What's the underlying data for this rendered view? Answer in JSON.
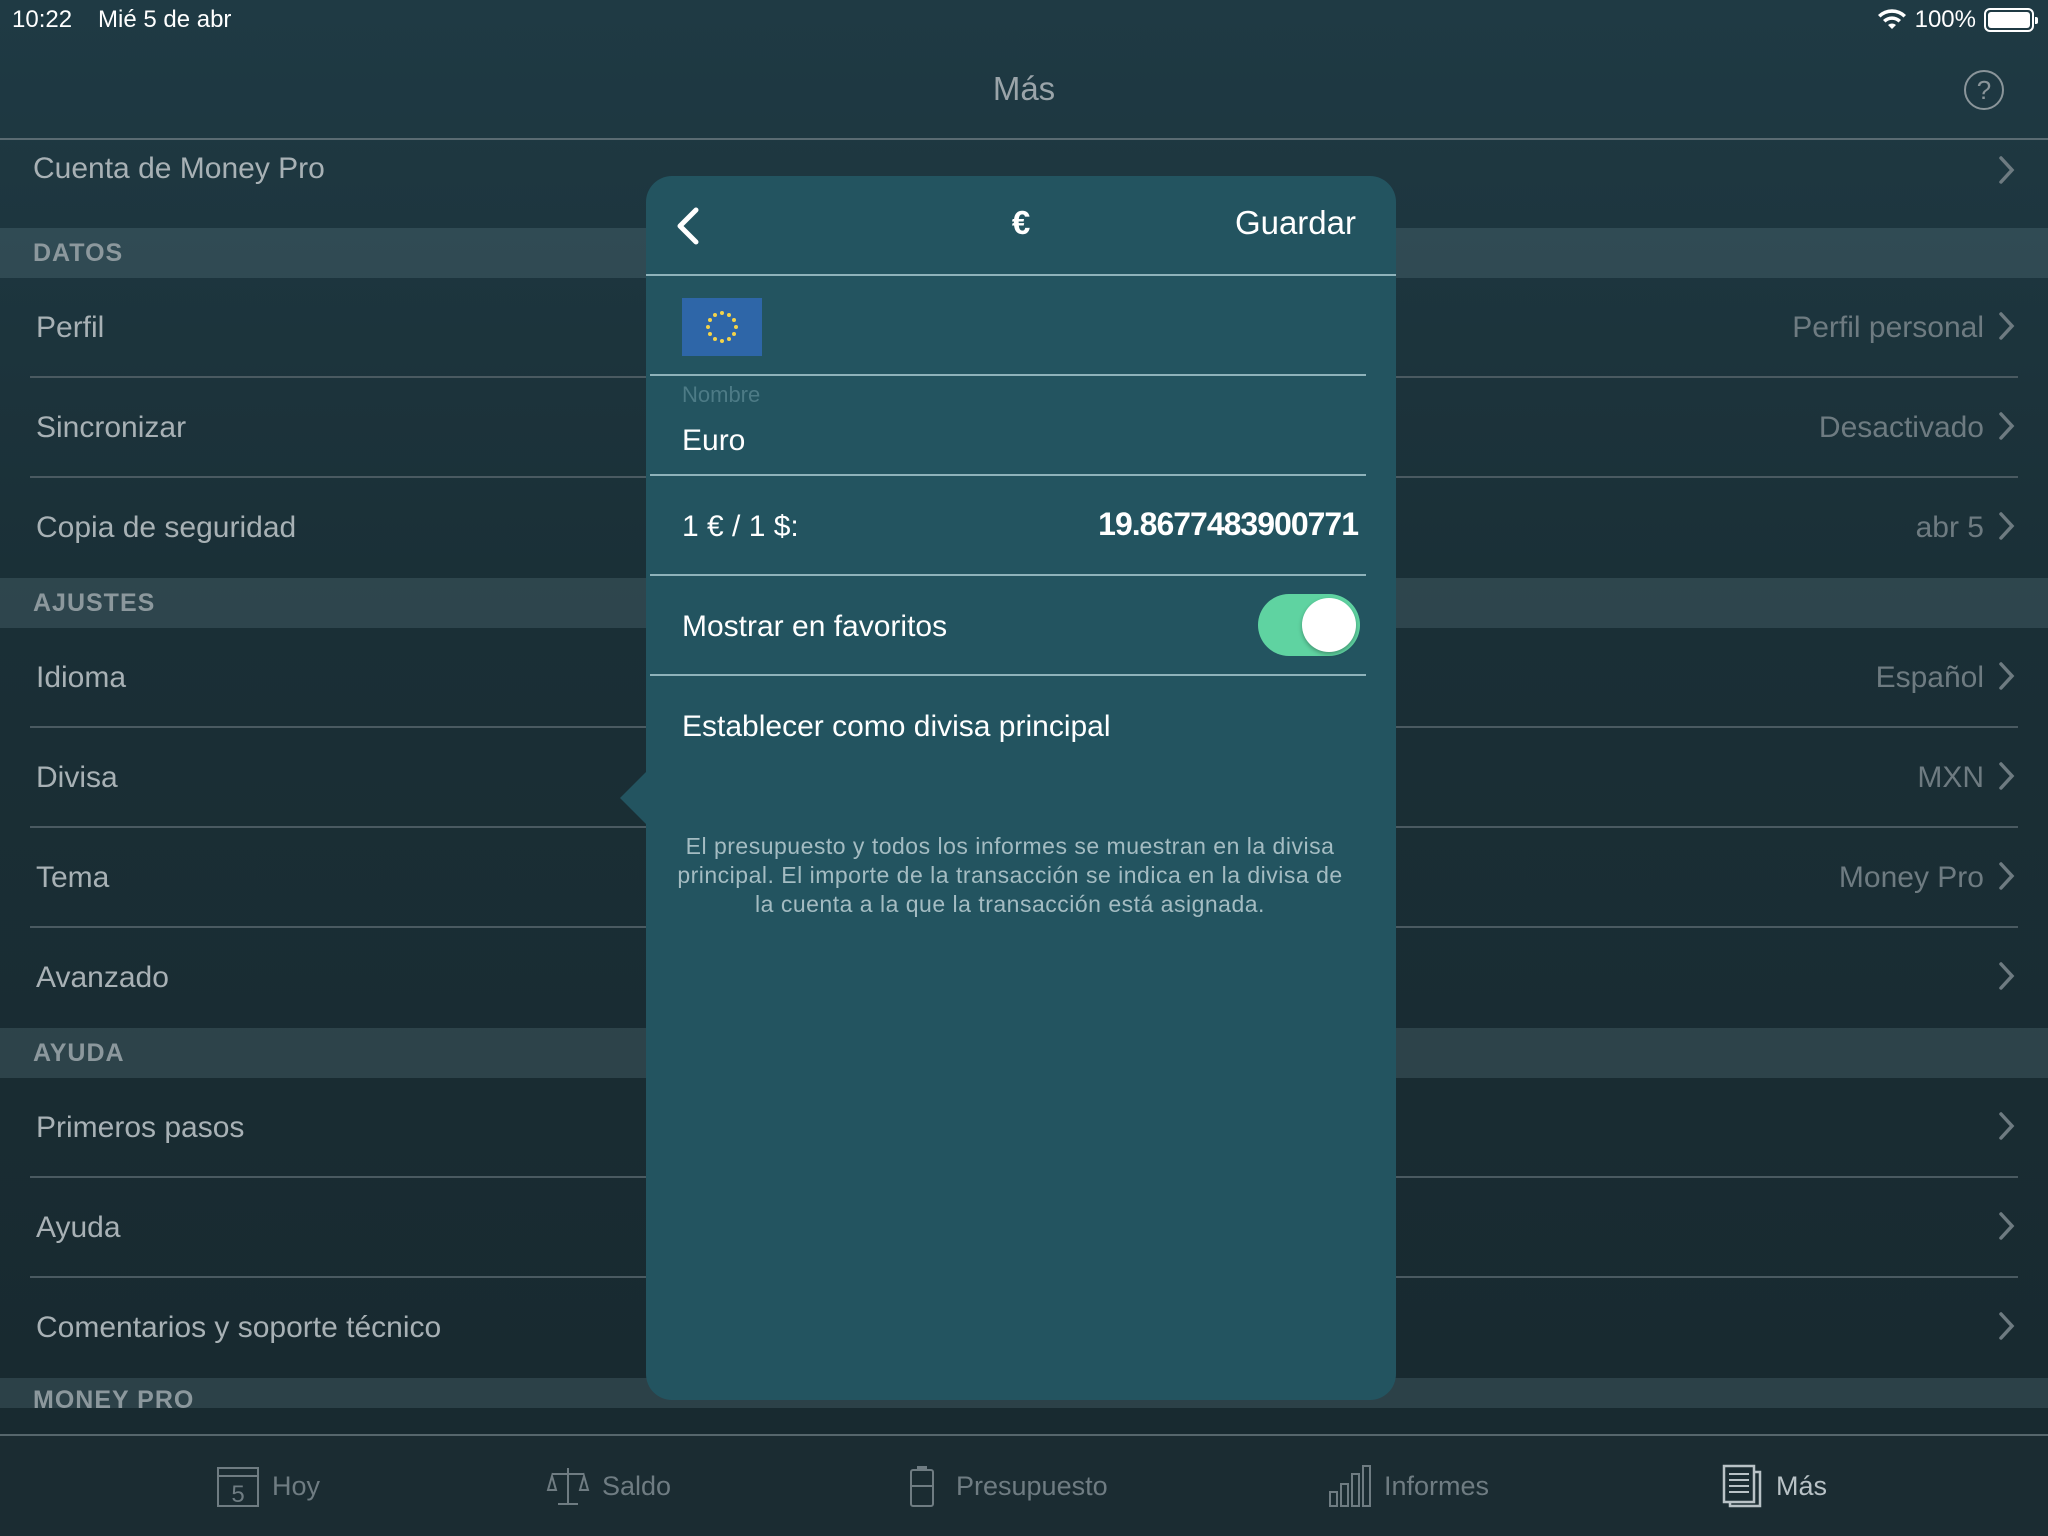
{
  "status": {
    "time": "10:22",
    "date": "Mié 5 de abr",
    "battery": "100%",
    "battery_level": 1.0
  },
  "nav": {
    "title": "Más",
    "help": "?"
  },
  "account_row": {
    "label": "Cuenta de Money Pro"
  },
  "sections": {
    "datos": {
      "header": "DATOS",
      "rows": [
        {
          "label": "Perfil",
          "value": "Perfil personal"
        },
        {
          "label": "Sincronizar",
          "value": "Desactivado"
        },
        {
          "label": "Copia de seguridad",
          "value": "abr 5"
        }
      ]
    },
    "ajustes": {
      "header": "AJUSTES",
      "rows": [
        {
          "label": "Idioma",
          "value": "Español"
        },
        {
          "label": "Divisa",
          "value": "MXN"
        },
        {
          "label": "Tema",
          "value": "Money Pro"
        },
        {
          "label": "Avanzado",
          "value": ""
        }
      ]
    },
    "ayuda": {
      "header": "AYUDA",
      "rows": [
        {
          "label": "Primeros pasos",
          "value": ""
        },
        {
          "label": "Ayuda",
          "value": ""
        },
        {
          "label": "Comentarios y soporte técnico",
          "value": ""
        }
      ]
    },
    "money_pro": {
      "header": "MONEY PRO"
    }
  },
  "popover": {
    "title": "€",
    "save": "Guardar",
    "name_caption": "Nombre",
    "name_value": "Euro",
    "rate_label": "1 € / 1 $:",
    "rate_value": "19.8677483900771",
    "favorites_label": "Mostrar en favoritos",
    "favorites_on": true,
    "main_currency_label": "Establecer como divisa principal",
    "note": "El presupuesto y todos los informes se muestran en la divisa principal. El importe de la transacción se indica en la divisa de la cuenta a la que la transacción está asignada."
  },
  "tabs": [
    {
      "label": "Hoy",
      "icon": "calendar-icon",
      "calendar_day": "5"
    },
    {
      "label": "Saldo",
      "icon": "scale-icon"
    },
    {
      "label": "Presupuesto",
      "icon": "battery-budget-icon"
    },
    {
      "label": "Informes",
      "icon": "bar-chart-icon"
    },
    {
      "label": "Más",
      "icon": "document-list-icon",
      "active": true
    }
  ],
  "colors": {
    "popover_bg": "#235460",
    "toggle_on": "#5fd3a1",
    "eu_flag_blue": "#2e66a8",
    "eu_flag_stars": "#f3d34a"
  }
}
